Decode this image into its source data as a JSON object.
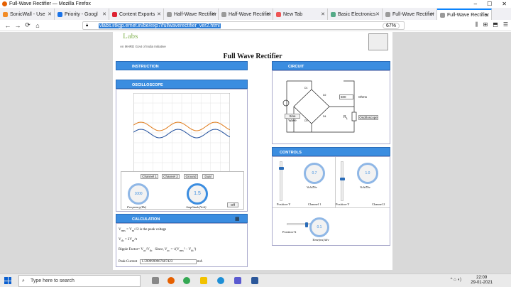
{
  "window": {
    "title": "Full-Wave Rectifier — Mozilla Firefox",
    "controls": [
      "–",
      "☐",
      "✕"
    ]
  },
  "tabs": [
    {
      "label": "SonicWall - Use",
      "color": "#f28c28"
    },
    {
      "label": "Priority - Googl",
      "color": "#1a73e8"
    },
    {
      "label": "Content Exports",
      "color": "#d23"
    },
    {
      "label": "Half-Wave Rectifier",
      "color": "#9a9a9a"
    },
    {
      "label": "Half-Wave Rectifier",
      "color": "#9a9a9a"
    },
    {
      "label": "New Tab",
      "color": "#e55"
    },
    {
      "label": "Basic Electronics",
      "color": "#5a8"
    },
    {
      "label": "Full-Wave Rectifier",
      "color": "#9a9a9a"
    },
    {
      "label": "Full-Wave Rectifier",
      "color": "#9a9a9a",
      "active": true
    }
  ],
  "nav": {
    "back": "←",
    "forward": "→",
    "reload": "⟳",
    "home": "⌂",
    "url": "vlabs.iitkgp.ernet.in/be/exp7/fullwaverectifier_ver2.html",
    "zoom": "67%",
    "star": "☆",
    "tools": [
      "⫼",
      "⊞",
      "⬒",
      "☰"
    ]
  },
  "page": {
    "logo": "Labs",
    "logo_sub": "An MHRD Govt of India Initiative",
    "title": "Full Wave Rectifier",
    "sections": {
      "instruction": "INSTRUCTION",
      "oscilloscope": "OSCILLOSCOPE",
      "circuit": "CIRCUIT",
      "controls": "CONTROLS",
      "calculation": "CALCULATION"
    },
    "scope_buttons": [
      "Channel 1",
      "Channel 2",
      "Ground",
      "Dual"
    ],
    "knobs": {
      "frequency": {
        "value": "1000",
        "label": "Frequency(Hz)"
      },
      "amplitude": {
        "value": "1.5",
        "label": "Amplitude(Volt)"
      },
      "off": "Off"
    },
    "circuit": {
      "resistance": "500",
      "ohms": "Ohms",
      "sine_wave": "Sine Wave",
      "oscilloscope": "Oscilloscope",
      "rl": "R",
      "rl_sub": "L",
      "d1": "D1",
      "d2": "D2",
      "d3": "D3",
      "d4": "D4"
    },
    "controls": {
      "ch1": {
        "value": "0.7",
        "label": "Volt/Div",
        "pos": "Position-Y",
        "name": "Channel 1",
        "level": 0.13
      },
      "ch2": {
        "value": "1.0",
        "label": "Volt/Div",
        "pos": "Position-Y",
        "name": "Channel 2",
        "level": 0.43
      },
      "time": {
        "value": "0.1",
        "label": "Time(ms)/div",
        "pos": "Position-X",
        "level": 0.65
      }
    },
    "calc": {
      "vrms": "V",
      "vrms_sub": "rms",
      "vrms_eq": "= V",
      "vrms_eq_sub": "m",
      "vrms_den": "√2",
      "vrms_text": "is the peak voltage",
      "vdc": "V",
      "vdc_sub": "dc",
      "vdc_eq": "= 2V",
      "vdc_eq_sub": "m",
      "vdc_den": "π",
      "ripple": "Ripple Factor=",
      "ripple_frac": "V",
      "ripple_frac_sub": "ac",
      "ripple_frac_den": "V",
      "ripple_frac_den_sub": "dc",
      "since": "Since, V",
      "since_sub": "ac",
      "since_eq": "= √(V",
      "since_v1_sub": "rms",
      "since_mid": "² − V",
      "since_v2_sub": "dc",
      "since_end": "²)",
      "peak_label": "Peak Current",
      "peak_value": "1.5999999967607423",
      "peak_unit": "mA"
    }
  },
  "taskbar": {
    "search_placeholder": "Type here to search",
    "time": "22:09",
    "date": "29-01-2021",
    "tray": "^ ⌂ ◖)"
  }
}
